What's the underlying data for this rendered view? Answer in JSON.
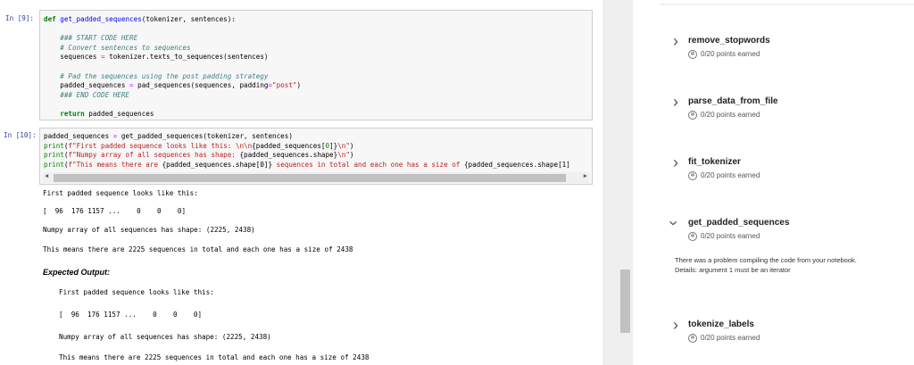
{
  "cells": [
    {
      "prompt": "In [9]:",
      "lines": [
        [
          [
            "kw",
            "def "
          ],
          [
            "fn",
            "get_padded_sequences"
          ],
          [
            "",
            "(tokenizer, sentences):"
          ]
        ],
        [
          [
            "",
            ""
          ]
        ],
        [
          [
            "cm",
            "    ### START CODE HERE"
          ]
        ],
        [
          [
            "cm",
            "    # Convert sentences to sequences"
          ]
        ],
        [
          [
            "",
            "    sequences "
          ],
          [
            "op",
            "="
          ],
          [
            "",
            " tokenizer.texts_to_sequences(sentences)"
          ]
        ],
        [
          [
            "",
            ""
          ]
        ],
        [
          [
            "cm",
            "    # Pad the sequences using the post padding strategy"
          ]
        ],
        [
          [
            "",
            "    padded_sequences "
          ],
          [
            "op",
            "="
          ],
          [
            "",
            " pad_sequences(sequences, padding"
          ],
          [
            "op",
            "="
          ],
          [
            "st",
            "\"post\""
          ],
          [
            "",
            ")"
          ]
        ],
        [
          [
            "cm",
            "    ### END CODE HERE"
          ]
        ],
        [
          [
            "",
            ""
          ]
        ],
        [
          [
            "kw",
            "    return"
          ],
          [
            "",
            " padded_sequences"
          ]
        ]
      ]
    },
    {
      "prompt": "In [10]:",
      "lines": [
        [
          [
            "",
            "padded_sequences "
          ],
          [
            "op",
            "="
          ],
          [
            "",
            " get_padded_sequences(tokenizer, sentences)"
          ]
        ],
        [
          [
            "nm",
            "print"
          ],
          [
            "",
            "("
          ],
          [
            "st",
            "f\"First padded sequence looks like this: \\n\\n"
          ],
          [
            "",
            "{padded_sequences["
          ],
          [
            "nm",
            "0"
          ],
          [
            "",
            "]}"
          ],
          [
            "st",
            "\\n\""
          ],
          [
            "",
            ")"
          ]
        ],
        [
          [
            "nm",
            "print"
          ],
          [
            "",
            "("
          ],
          [
            "st",
            "f\"Numpy array of all sequences has shape: "
          ],
          [
            "",
            "{padded_sequences.shape}"
          ],
          [
            "st",
            "\\n\""
          ],
          [
            "",
            ")"
          ]
        ],
        [
          [
            "nm",
            "print"
          ],
          [
            "",
            "("
          ],
          [
            "st",
            "f\"This means there are "
          ],
          [
            "",
            "{padded_sequences.shape[0]}"
          ],
          [
            "st",
            " sequences in total and each one has a size of "
          ],
          [
            "",
            "{padded_sequences.shape[1]"
          ]
        ]
      ]
    }
  ],
  "output": [
    "First padded sequence looks like this:",
    "[  96  176 1157 ...    0    0    0]",
    "Numpy array of all sequences has shape: (2225, 2438)",
    "This means there are 2225 sequences in total and each one has a size of 2438"
  ],
  "expected": {
    "title": "Expected Output:",
    "lines": [
      "First padded sequence looks like this:",
      "[  96  176 1157 ...    0    0    0]",
      "Numpy array of all sequences has shape: (2225, 2438)",
      "This means there are 2225 sequences in total and each one has a size of 2438"
    ]
  },
  "tasks": [
    {
      "name": "remove_stopwords",
      "points": "0/20 points earned",
      "expanded": false
    },
    {
      "name": "parse_data_from_file",
      "points": "0/20 points earned",
      "expanded": false
    },
    {
      "name": "fit_tokenizer",
      "points": "0/20 points earned",
      "expanded": false
    },
    {
      "name": "get_padded_sequences",
      "points": "0/20 points earned",
      "expanded": true,
      "error": "There was a problem compiling the code from your notebook. Details: argument 1 must be an iterator"
    },
    {
      "name": "tokenize_labels",
      "points": "0/20 points earned",
      "expanded": false
    }
  ]
}
